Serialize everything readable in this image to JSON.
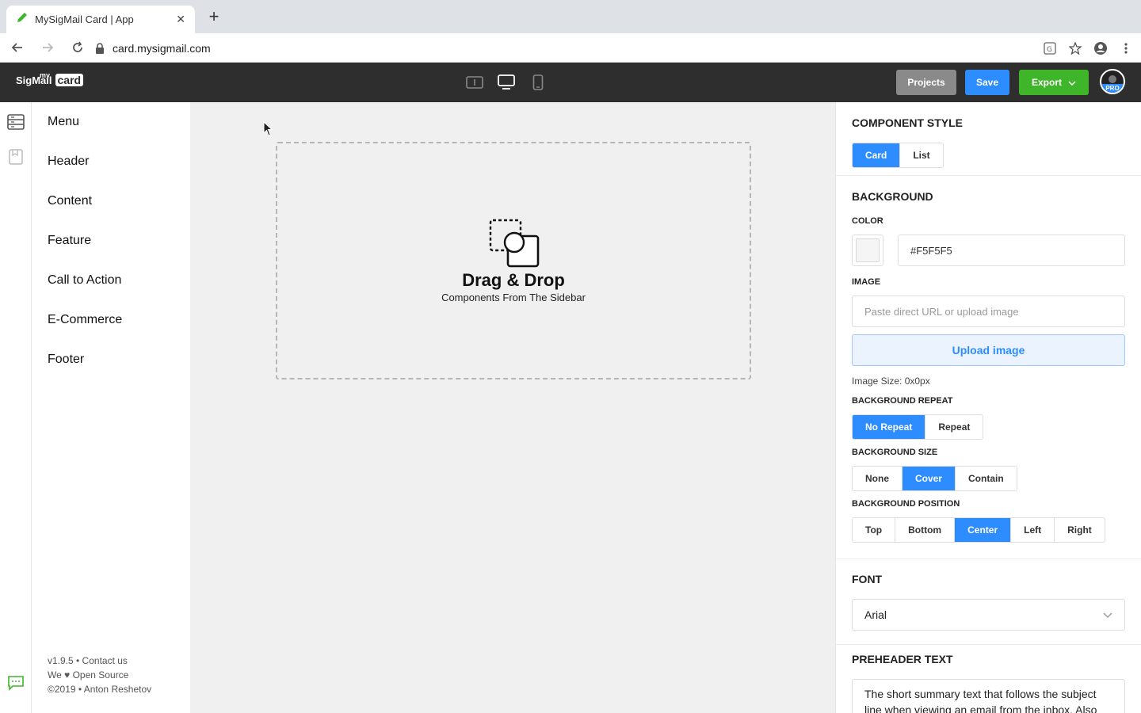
{
  "browser": {
    "tab_title": "MySigMail Card | App",
    "url": "card.mysigmail.com"
  },
  "app": {
    "logo_my": "my",
    "logo_sigmail": "SigMail",
    "logo_card": "card",
    "buttons": {
      "projects": "Projects",
      "save": "Save",
      "export": "Export"
    },
    "avatar_badge": "PRO"
  },
  "sidebar": {
    "items": [
      "Menu",
      "Header",
      "Content",
      "Feature",
      "Call to Action",
      "E-Commerce",
      "Footer"
    ],
    "footer": {
      "line1": "v1.9.5 • Contact us",
      "line2": "We ♥ Open Source",
      "line3": "©2019 • Anton Reshetov"
    }
  },
  "canvas": {
    "title": "Drag & Drop",
    "subtitle": "Components From The Sidebar"
  },
  "panel": {
    "component_style": {
      "title": "COMPONENT STYLE",
      "options": [
        "Card",
        "List"
      ],
      "active": "Card"
    },
    "background": {
      "title": "BACKGROUND",
      "color_label": "COLOR",
      "color_value": "#F5F5F5",
      "image_label": "IMAGE",
      "image_placeholder": "Paste direct URL or upload image",
      "upload_label": "Upload image",
      "image_size": "Image Size: 0x0px",
      "repeat_label": "BACKGROUND REPEAT",
      "repeat_options": [
        "No Repeat",
        "Repeat"
      ],
      "repeat_active": "No Repeat",
      "size_label": "BACKGROUND SIZE",
      "size_options": [
        "None",
        "Cover",
        "Contain"
      ],
      "size_active": "Cover",
      "position_label": "BACKGROUND POSITION",
      "position_options": [
        "Top",
        "Bottom",
        "Center",
        "Left",
        "Right"
      ],
      "position_active": "Center"
    },
    "font": {
      "title": "FONT",
      "value": "Arial"
    },
    "preheader": {
      "title": "PREHEADER TEXT",
      "value": "The short summary text that follows the subject line when viewing an email from the inbox. Also"
    }
  },
  "colors": {
    "accent": "#2d8cff",
    "export_green": "#3fb52a",
    "appbar": "#2e2e2e",
    "canvas_bg": "#f0f0f0"
  }
}
